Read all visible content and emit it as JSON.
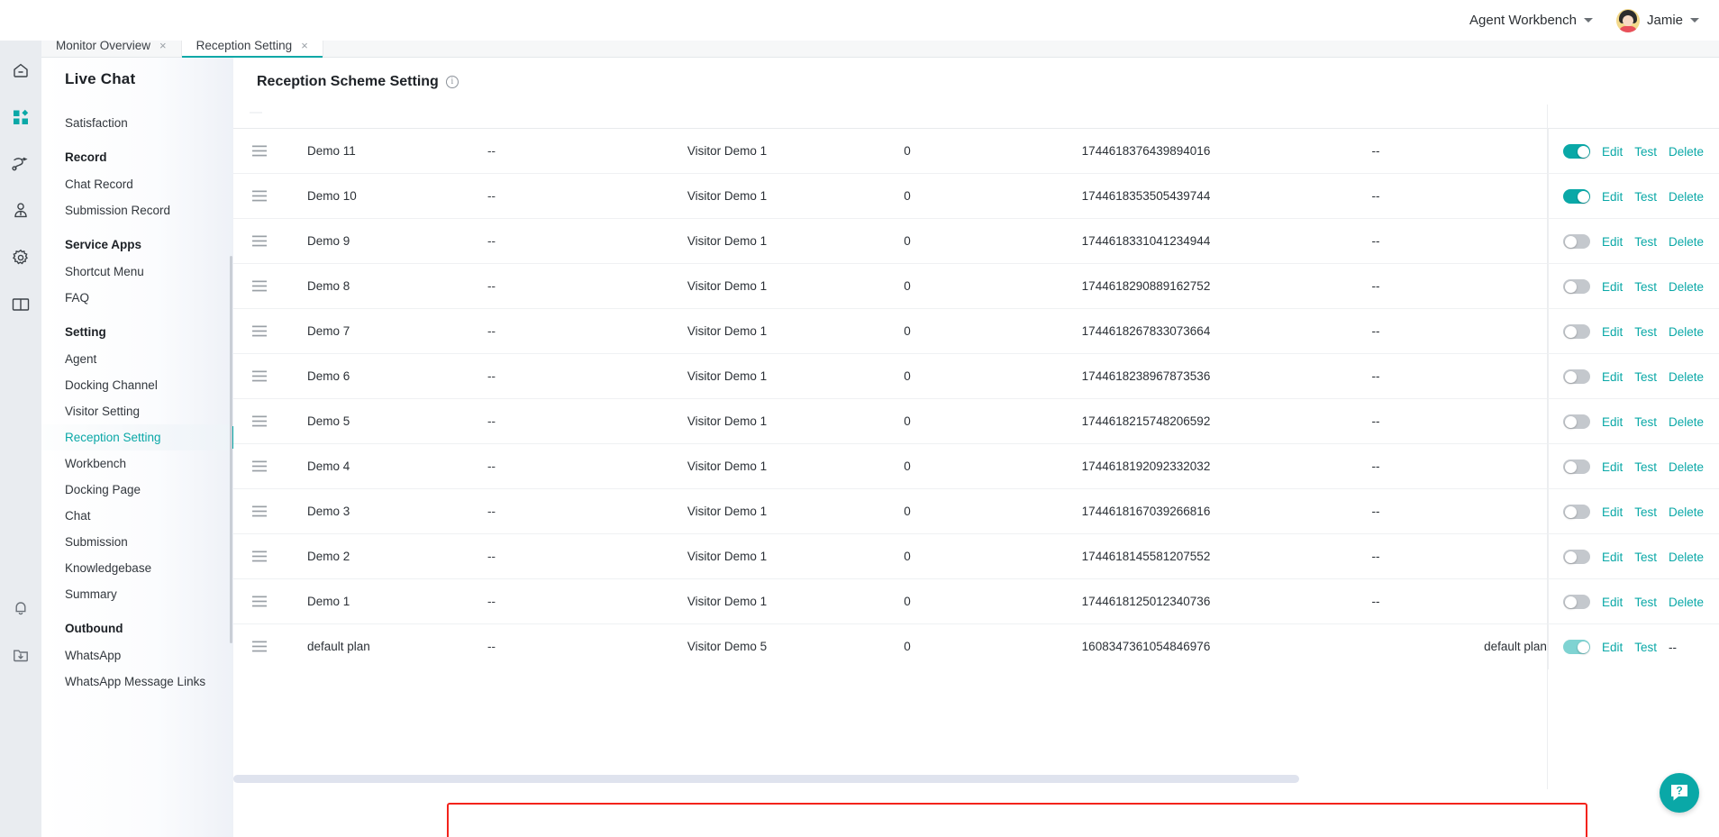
{
  "topbar": {
    "workbench_label": "Agent Workbench",
    "user_name": "Jamie"
  },
  "tabs": [
    {
      "label": "Monitor Overview",
      "close": "×",
      "active": false
    },
    {
      "label": "Reception Setting",
      "close": "×",
      "active": true
    }
  ],
  "sidebar": {
    "title": "Live Chat",
    "groups": [
      {
        "label": "",
        "items": [
          {
            "label": "Satisfaction",
            "active": false
          }
        ]
      },
      {
        "label": "Record",
        "items": [
          {
            "label": "Chat Record",
            "active": false
          },
          {
            "label": "Submission Record",
            "active": false
          }
        ]
      },
      {
        "label": "Service Apps",
        "items": [
          {
            "label": "Shortcut Menu",
            "active": false
          },
          {
            "label": "FAQ",
            "active": false
          }
        ]
      },
      {
        "label": "Setting",
        "items": [
          {
            "label": "Agent",
            "active": false
          },
          {
            "label": "Docking Channel",
            "active": false
          },
          {
            "label": "Visitor Setting",
            "active": false
          },
          {
            "label": "Reception Setting",
            "active": true
          },
          {
            "label": "Workbench",
            "active": false
          },
          {
            "label": "Docking Page",
            "active": false
          },
          {
            "label": "Chat",
            "active": false
          },
          {
            "label": "Submission",
            "active": false
          },
          {
            "label": "Knowledgebase",
            "active": false
          },
          {
            "label": "Summary",
            "active": false
          }
        ]
      },
      {
        "label": "Outbound",
        "items": [
          {
            "label": "WhatsApp",
            "active": false
          },
          {
            "label": "WhatsApp Message Links",
            "active": false
          }
        ]
      }
    ]
  },
  "page": {
    "title": "Reception Scheme Setting",
    "info_icon": "i"
  },
  "actions": {
    "edit": "Edit",
    "test": "Test",
    "delete": "Delete",
    "delete_disabled": "--"
  },
  "table": {
    "rows": [
      {
        "name": "Demo 11",
        "dash1": "--",
        "visitor": "Visitor Demo 1",
        "num": "0",
        "id": "1744618376439894016",
        "dash2": "--",
        "extra": "",
        "enabled": true,
        "light": false,
        "deletable": true,
        "highlight": false
      },
      {
        "name": "Demo 10",
        "dash1": "--",
        "visitor": "Visitor Demo 1",
        "num": "0",
        "id": "1744618353505439744",
        "dash2": "--",
        "extra": "",
        "enabled": true,
        "light": false,
        "deletable": true,
        "highlight": false
      },
      {
        "name": "Demo 9",
        "dash1": "--",
        "visitor": "Visitor Demo 1",
        "num": "0",
        "id": "1744618331041234944",
        "dash2": "--",
        "extra": "",
        "enabled": false,
        "light": false,
        "deletable": true,
        "highlight": false
      },
      {
        "name": "Demo 8",
        "dash1": "--",
        "visitor": "Visitor Demo 1",
        "num": "0",
        "id": "1744618290889162752",
        "dash2": "--",
        "extra": "",
        "enabled": false,
        "light": false,
        "deletable": true,
        "highlight": false
      },
      {
        "name": "Demo 7",
        "dash1": "--",
        "visitor": "Visitor Demo 1",
        "num": "0",
        "id": "1744618267833073664",
        "dash2": "--",
        "extra": "",
        "enabled": false,
        "light": false,
        "deletable": true,
        "highlight": false
      },
      {
        "name": "Demo 6",
        "dash1": "--",
        "visitor": "Visitor Demo 1",
        "num": "0",
        "id": "1744618238967873536",
        "dash2": "--",
        "extra": "",
        "enabled": false,
        "light": false,
        "deletable": true,
        "highlight": false
      },
      {
        "name": "Demo 5",
        "dash1": "--",
        "visitor": "Visitor Demo 1",
        "num": "0",
        "id": "1744618215748206592",
        "dash2": "--",
        "extra": "",
        "enabled": false,
        "light": false,
        "deletable": true,
        "highlight": false
      },
      {
        "name": "Demo 4",
        "dash1": "--",
        "visitor": "Visitor Demo 1",
        "num": "0",
        "id": "1744618192092332032",
        "dash2": "--",
        "extra": "",
        "enabled": false,
        "light": false,
        "deletable": true,
        "highlight": false
      },
      {
        "name": "Demo 3",
        "dash1": "--",
        "visitor": "Visitor Demo 1",
        "num": "0",
        "id": "1744618167039266816",
        "dash2": "--",
        "extra": "",
        "enabled": false,
        "light": false,
        "deletable": true,
        "highlight": false
      },
      {
        "name": "Demo 2",
        "dash1": "--",
        "visitor": "Visitor Demo 1",
        "num": "0",
        "id": "1744618145581207552",
        "dash2": "--",
        "extra": "",
        "enabled": false,
        "light": false,
        "deletable": true,
        "highlight": false
      },
      {
        "name": "Demo 1",
        "dash1": "--",
        "visitor": "Visitor Demo 1",
        "num": "0",
        "id": "1744618125012340736",
        "dash2": "--",
        "extra": "",
        "enabled": false,
        "light": false,
        "deletable": true,
        "highlight": false
      },
      {
        "name": "default plan",
        "dash1": "--",
        "visitor": "Visitor Demo 5",
        "num": "0",
        "id": "1608347361054846976",
        "dash2": "",
        "extra": "default plan",
        "enabled": true,
        "light": true,
        "deletable": false,
        "highlight": true
      }
    ]
  },
  "colors": {
    "accent": "#0aa8a7",
    "highlight": "#f3231b",
    "rail_bg": "#e9ecf0",
    "toggle_off": "#c4c8cd"
  },
  "help": {
    "icon": "?"
  }
}
